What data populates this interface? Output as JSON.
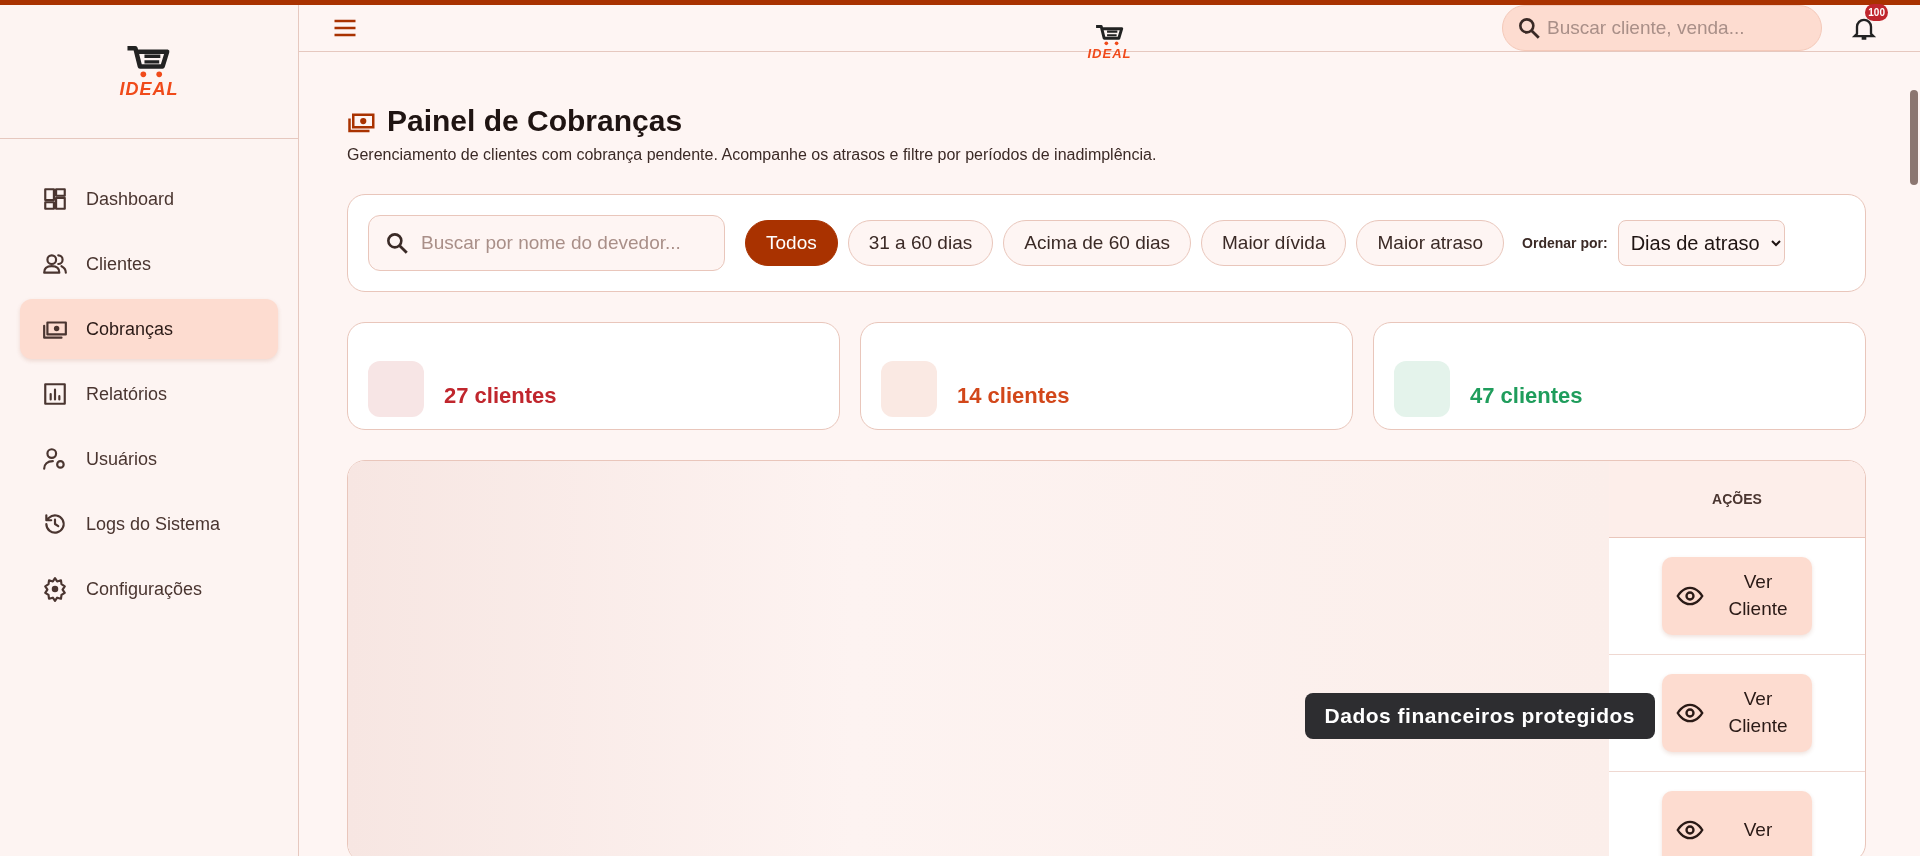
{
  "top_bar": {
    "logo": "IDEAL",
    "search": {
      "placeholder": "Buscar cliente, venda..."
    },
    "notifications": {
      "badge": "100"
    }
  },
  "sidebar": {
    "logo": "IDEAL",
    "items": [
      {
        "label": "Dashboard",
        "kind": "dashboard",
        "selected": false
      },
      {
        "label": "Clientes",
        "kind": "users",
        "selected": false
      },
      {
        "label": "Cobranças",
        "kind": "money",
        "selected": true
      },
      {
        "label": "Relatórios",
        "kind": "chart",
        "selected": false
      },
      {
        "label": "Usuários",
        "kind": "usergear",
        "selected": false
      },
      {
        "label": "Logs do Sistema",
        "kind": "history",
        "selected": false
      },
      {
        "label": "Configurações",
        "kind": "gear",
        "selected": false
      }
    ]
  },
  "page": {
    "title": "Painel de Cobranças",
    "subtitle": "Gerenciamento de clientes com cobrança pendente. Acompanhe os atrasos e filtre por períodos de inadimplência."
  },
  "filters": {
    "search": {
      "placeholder": "Buscar por nome do devedor..."
    },
    "chips": [
      {
        "label": "Todos",
        "selected": true
      },
      {
        "label": "31 a 60 dias",
        "selected": false
      },
      {
        "label": "Acima de 60 dias",
        "selected": false
      },
      {
        "label": "Maior dívida",
        "selected": false
      },
      {
        "label": "Maior atraso",
        "selected": false
      }
    ],
    "sort": {
      "label": "Ordenar por:",
      "value": "Dias de atraso"
    }
  },
  "summary_cards": [
    {
      "count": "27 clientes",
      "color": "#c0262d"
    },
    {
      "count": "14 clientes",
      "color": "#d2471a"
    },
    {
      "count": "47 clientes",
      "color": "#1f9d5c"
    }
  ],
  "table": {
    "columns": [
      "AÇÕES"
    ],
    "rows": [
      {
        "action": "Ver Cliente"
      },
      {
        "action": "Ver Cliente"
      },
      {
        "action": "Ver"
      }
    ]
  },
  "privacy_notice": "Dados financeiros protegidos"
}
